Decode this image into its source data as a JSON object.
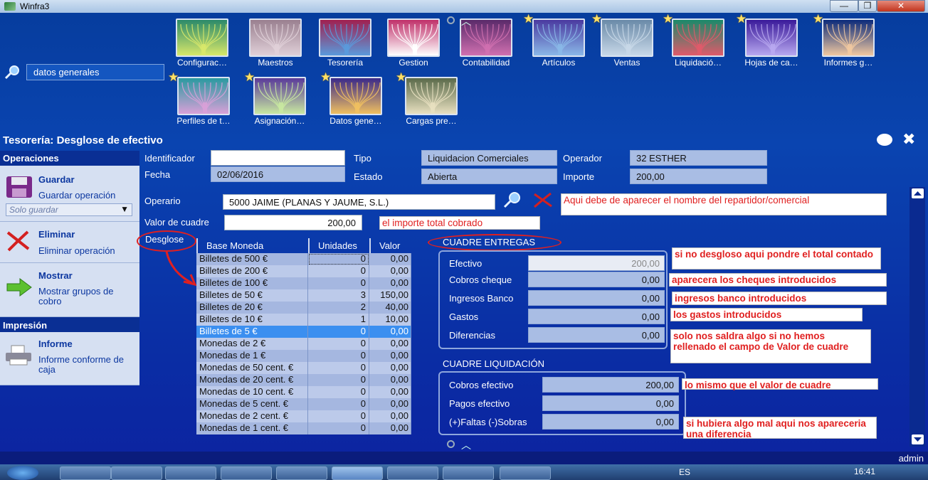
{
  "window": {
    "title": "Winfra3",
    "controls": {
      "minimize": "—",
      "maximize": "❐",
      "close": "✕"
    }
  },
  "tiles": [
    {
      "label": "Configurac…",
      "star": false,
      "colors": [
        "#2b8a6a",
        "#d8e86a"
      ]
    },
    {
      "label": "Maestros",
      "star": false,
      "colors": [
        "#9a8090",
        "#e0d0d8"
      ]
    },
    {
      "label": "Tesorería",
      "star": false,
      "colors": [
        "#a02050",
        "#5a9adc"
      ]
    },
    {
      "label": "Gestion",
      "star": false,
      "colors": [
        "#c0306a",
        "#ffffff"
      ]
    },
    {
      "label": "Contabilidad",
      "star": false,
      "colors": [
        "#5a2a6a",
        "#d070b0"
      ]
    },
    {
      "label": "Artículos",
      "star": true,
      "colors": [
        "#4a3aa0",
        "#8ab8e8"
      ]
    },
    {
      "label": "Ventas",
      "star": true,
      "colors": [
        "#6a8aa8",
        "#c8d8e8"
      ]
    },
    {
      "label": "Liquidació…",
      "star": true,
      "colors": [
        "#1a8a6a",
        "#e05a6a"
      ]
    },
    {
      "label": "Hojas de ca…",
      "star": true,
      "colors": [
        "#3a1a9a",
        "#b8a8f0"
      ]
    },
    {
      "label": "Informes g…",
      "star": true,
      "colors": [
        "#0a2a7a",
        "#f0c8a0"
      ]
    },
    {
      "label": "Perfiles de t…",
      "star": true,
      "colors": [
        "#2a9aa0",
        "#d8a0d8"
      ]
    },
    {
      "label": "Asignación…",
      "star": true,
      "colors": [
        "#5a3a9a",
        "#c8e8a0"
      ]
    },
    {
      "label": "Datos gene…",
      "star": true,
      "colors": [
        "#3a2a8a",
        "#f0c060"
      ]
    },
    {
      "label": "Cargas pre…",
      "star": true,
      "colors": [
        "#5a6a4a",
        "#e8e0c0"
      ]
    }
  ],
  "search": {
    "value": "datos generales"
  },
  "module": {
    "title": "Tesorería: Desglose de efectivo"
  },
  "left": {
    "operaciones": "Operaciones",
    "guardar": {
      "title": "Guardar",
      "subtitle": "Guardar operación",
      "select": "Solo guardar"
    },
    "eliminar": {
      "title": "Eliminar",
      "subtitle": "Eliminar operación"
    },
    "mostrar": {
      "title": "Mostrar",
      "subtitle": "Mostrar grupos de cobro"
    },
    "impresion": "Impresión",
    "informe": {
      "title": "Informe",
      "subtitle": "Informe conforme de caja"
    }
  },
  "form": {
    "identificador": {
      "label": "Identificador",
      "value": ""
    },
    "fecha": {
      "label": "Fecha",
      "value": "02/06/2016"
    },
    "tipo": {
      "label": "Tipo",
      "value": "Liquidacion Comerciales"
    },
    "estado": {
      "label": "Estado",
      "value": "Abierta"
    },
    "operador": {
      "label": "Operador",
      "value": "32 ESTHER"
    },
    "importe": {
      "label": "Importe",
      "value": "200,00"
    },
    "operario": {
      "label": "Operario",
      "value": "5000 JAIME (PLANAS Y JAUME, S.L.)"
    },
    "valor_cuadre": {
      "label": "Valor de cuadre",
      "value": "200,00"
    },
    "desglose_label": "Desglose"
  },
  "table": {
    "headers": [
      "Base Moneda",
      "Unidades",
      "Valor"
    ],
    "rows": [
      {
        "base": "Billetes de 500 €",
        "unidades": "0",
        "valor": "0,00"
      },
      {
        "base": "Billetes de 200 €",
        "unidades": "0",
        "valor": "0,00"
      },
      {
        "base": "Billetes de 100 €",
        "unidades": "0",
        "valor": "0,00"
      },
      {
        "base": "Billetes de 50 €",
        "unidades": "3",
        "valor": "150,00"
      },
      {
        "base": "Billetes de 20 €",
        "unidades": "2",
        "valor": "40,00"
      },
      {
        "base": "Billetes de 10 €",
        "unidades": "1",
        "valor": "10,00"
      },
      {
        "base": "Billetes de 5 €",
        "unidades": "0",
        "valor": "0,00",
        "selected": true
      },
      {
        "base": "Monedas de 2 €",
        "unidades": "0",
        "valor": "0,00"
      },
      {
        "base": "Monedas de 1 €",
        "unidades": "0",
        "valor": "0,00"
      },
      {
        "base": "Monedas de 50 cent. €",
        "unidades": "0",
        "valor": "0,00"
      },
      {
        "base": "Monedas de 20 cent. €",
        "unidades": "0",
        "valor": "0,00"
      },
      {
        "base": "Monedas de 10 cent. €",
        "unidades": "0",
        "valor": "0,00"
      },
      {
        "base": "Monedas de 5 cent. €",
        "unidades": "0",
        "valor": "0,00"
      },
      {
        "base": "Monedas de 2 cent. €",
        "unidades": "0",
        "valor": "0,00"
      },
      {
        "base": "Monedas de 1 cent. €",
        "unidades": "0",
        "valor": "0,00"
      }
    ]
  },
  "cuadre_entregas": {
    "title": "CUADRE ENTREGAS",
    "rows": [
      {
        "label": "Efectivo",
        "value": "200,00"
      },
      {
        "label": "Cobros cheque",
        "value": "0,00"
      },
      {
        "label": "Ingresos Banco",
        "value": "0,00"
      },
      {
        "label": "Gastos",
        "value": "0,00"
      },
      {
        "label": "Diferencias",
        "value": "0,00"
      }
    ]
  },
  "cuadre_liquidacion": {
    "title": "CUADRE LIQUIDACIÓN",
    "rows": [
      {
        "label": "Cobros efectivo",
        "value": "200,00"
      },
      {
        "label": "Pagos efectivo",
        "value": "0,00"
      },
      {
        "label": "(+)Faltas (-)Sobras",
        "value": "0,00"
      }
    ]
  },
  "notes": {
    "operario": "Aqui debe de aparecer el nombre del repartidor/comercial",
    "importe": "el importe total cobrado",
    "efectivo": "si no desgloso aqui pondre el total contado",
    "cheques": "aparecera los cheques introducidos",
    "banco": "ingresos banco introducidos",
    "gastos": "los gastos introducidos",
    "diferencias": "solo nos saldra algo si no hemos rellenado el campo de Valor de cuadre",
    "cobros": "lo mismo que el valor de cuadre",
    "faltas": "si hubiera algo mal aqui nos apareceria una diferencia"
  },
  "status": {
    "user": "admin"
  },
  "taskbar": {
    "lang": "ES",
    "time": "16:41"
  }
}
